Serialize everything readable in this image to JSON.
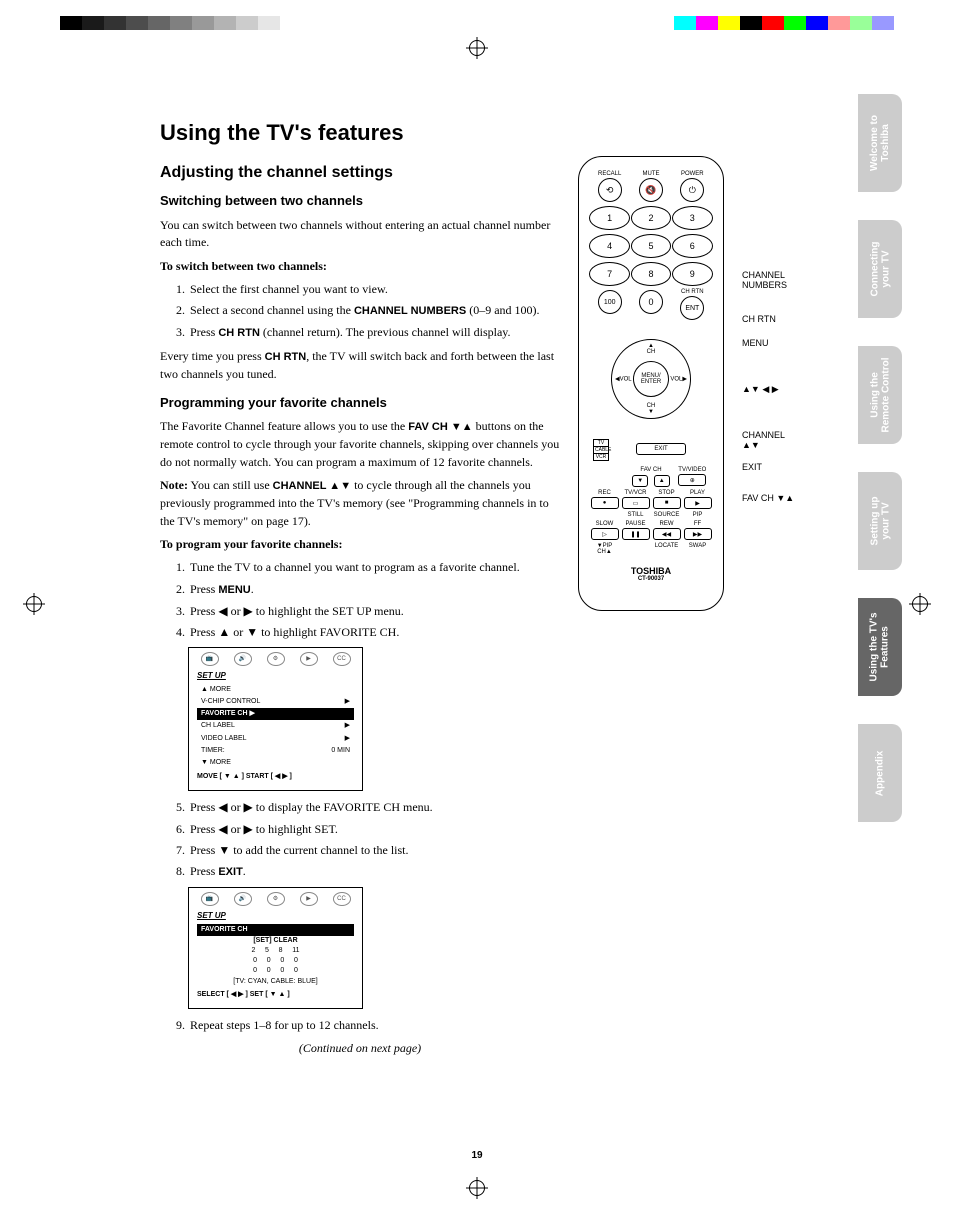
{
  "page_number": "19",
  "h1": "Using the TV's features",
  "h2": "Adjusting the channel settings",
  "sec1": {
    "h3": "Switching between two channels",
    "p1": "You can switch between two channels without entering an actual channel number each time.",
    "p2": "To switch between two channels:",
    "li1": "Select the first channel you want to view.",
    "li2a": "Select a second channel using the ",
    "li2b": "CHANNEL NUMBERS",
    "li2c": " (0–9 and 100).",
    "li3a": "Press ",
    "li3b": "CH RTN",
    "li3c": " (channel return). The previous channel will display.",
    "p3a": "Every time you press ",
    "p3b": "CH RTN",
    "p3c": ", the TV will switch back and forth between the last two channels you tuned."
  },
  "sec2": {
    "h3": "Programming your favorite channels",
    "p1a": "The Favorite Channel feature allows you to use the ",
    "p1b": "FAV CH ▼▲",
    "p1c": " buttons on the remote control to cycle through your favorite channels, skipping over channels you do not normally watch. You can program a maximum of 12 favorite channels.",
    "note_a": "Note:",
    "note_b": " You can still use ",
    "note_c": "CHANNEL ▲▼",
    "note_d": " to cycle through all the channels you previously programmed into the TV's memory (see \"Programming channels in to the TV's memory\" on page 17).",
    "p2": "To program your favorite channels:",
    "li1": "Tune the TV to a channel you want to program as a favorite channel.",
    "li2a": "Press ",
    "li2b": "MENU",
    "li2c": ".",
    "li3": "Press ◀ or ▶ to highlight the SET UP menu.",
    "li4": "Press ▲ or ▼ to highlight FAVORITE CH.",
    "li5": "Press ◀ or ▶ to display the FAVORITE CH menu.",
    "li6": "Press ◀ or ▶ to highlight SET.",
    "li7": "Press ▼ to add the current channel to the list.",
    "li8a": "Press ",
    "li8b": "EXIT",
    "li8c": ".",
    "li9": "Repeat steps 1–8 for up to 12 channels."
  },
  "continued": "(Continued on next page)",
  "osd1": {
    "title": "SET UP",
    "more_up": "▲ MORE",
    "r1a": "V-CHIP CONTROL",
    "r1b": "▶",
    "hl": "FAVORITE CH            ▶",
    "r2a": "CH LABEL",
    "r2b": "▶",
    "r3a": "VIDEO LABEL",
    "r3b": "▶",
    "r4a": "TIMER:",
    "r4b": "0 MIN",
    "more_dn": "▼ MORE",
    "ftr": "MOVE [ ▼ ▲ ]     START [ ◀  ▶ ]"
  },
  "osd2": {
    "title": "SET UP",
    "hl": "FAVORITE CH",
    "setclear": "[SET]  CLEAR",
    "row1": "2     5     8     11",
    "row2": "0     0     0     0",
    "row3": "0     0     0     0",
    "tvcable": "[TV: CYAN,  CABLE: BLUE]",
    "ftr": "SELECT [ ◀  ▶ ]    SET [ ▼ ▲ ]"
  },
  "remote": {
    "recall": "RECALL",
    "mute": "MUTE",
    "power": "POWER",
    "n1": "1",
    "n2": "2",
    "n3": "3",
    "n4": "4",
    "n5": "5",
    "n6": "6",
    "n7": "7",
    "n8": "8",
    "n9": "9",
    "n0": "0",
    "n100": "100",
    "chrtn": "CH RTN",
    "ent": "ENT",
    "ch": "CH",
    "vol": "VOL",
    "menu": "MENU/\nENTER",
    "tv": "TV",
    "cable": "CABLE",
    "vcr": "VCR",
    "exit": "EXIT",
    "favch": "FAV CH",
    "tvvideo": "TV/VIDEO",
    "rec": "REC",
    "tvvcr": "TV/VCR",
    "stop": "STOP",
    "play": "PLAY",
    "still": "STILL",
    "source": "SOURCE",
    "pip": "PIP",
    "slow": "SLOW",
    "pause": "PAUSE",
    "rew": "REW",
    "ff": "FF",
    "pipch": "PIP CH",
    "locate": "LOCATE",
    "swap": "SWAP",
    "logo": "TOSHIBA",
    "model": "CT-90037"
  },
  "callouts": {
    "channel_numbers": "CHANNEL\nNUMBERS",
    "chrtn": "CH RTN",
    "menu": "MENU",
    "arrows": "▲▼ ◀ ▶",
    "channel_ud": "CHANNEL\n▲▼",
    "exit": "EXIT",
    "favch": "FAV CH ▼▲"
  },
  "tabs": {
    "t1": "Welcome to\nToshiba",
    "t2": "Connecting\nyour TV",
    "t3": "Using the\nRemote Control",
    "t4": "Setting up\nyour TV",
    "t5": "Using the TV's\nFeatures",
    "t6": "Appendix"
  }
}
